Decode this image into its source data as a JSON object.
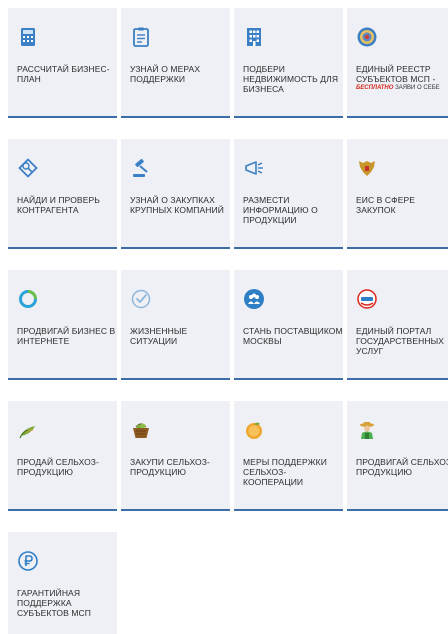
{
  "rows": [
    [
      {
        "label": "РАССЧИТАЙ БИЗНЕС-ПЛАН",
        "icon": "calculator-icon"
      },
      {
        "label": "УЗНАЙ О МЕРАХ ПОДДЕРЖКИ",
        "icon": "clipboard-icon"
      },
      {
        "label": "ПОДБЕРИ НЕДВИЖИМОСТЬ ДЛЯ БИЗНЕСА",
        "icon": "building-icon"
      },
      {
        "label": "ЕДИНЫЙ РЕЕСТР СУБЪЕКТОВ МСП -",
        "icon": "tax-service-emblem-icon",
        "note_red": "БЕСПЛАТНО",
        "note": "ЗАЯВИ О СЕБЕ"
      }
    ],
    [
      {
        "label": "НАЙДИ И ПРОВЕРЬ КОНТРАГЕНТА",
        "icon": "diamond-search-icon"
      },
      {
        "label": "УЗНАЙ О ЗАКУПКАХ КРУПНЫХ КОМПАНИЙ",
        "icon": "gavel-icon"
      },
      {
        "label": "РАЗМЕСТИ ИНФОРМАЦИЮ О ПРОДУКЦИИ",
        "icon": "megaphone-icon"
      },
      {
        "label": "ЕИС В СФЕРЕ ЗАКУПОК",
        "icon": "coat-of-arms-icon"
      }
    ],
    [
      {
        "label": "ПРОДВИГАЙ БИЗНЕС В ИНТЕРНЕТЕ",
        "icon": "ring-logo-icon"
      },
      {
        "label": "ЖИЗНЕННЫЕ СИТУАЦИИ",
        "icon": "checkmark-circle-icon"
      },
      {
        "label": "СТАНЬ ПОСТАВЩИКОМ МОСКВЫ",
        "icon": "people-circle-icon"
      },
      {
        "label": "ЕДИНЫЙ ПОРТАЛ ГОСУДАРСТВЕННЫХ УСЛУГ",
        "icon": "gosuslugi-logo-icon"
      }
    ],
    [
      {
        "label": "ПРОДАЙ СЕЛЬХОЗ-ПРОДУКЦИЮ",
        "icon": "sprout-icon"
      },
      {
        "label": "ЗАКУПИ СЕЛЬХОЗ-ПРОДУКЦИЮ",
        "icon": "basket-icon"
      },
      {
        "label": "МЕРЫ ПОДДЕРЖКИ СЕЛЬХОЗ-КООПЕРАЦИИ",
        "icon": "coin-leaf-icon"
      },
      {
        "label": "ПРОДВИГАЙ СЕЛЬХОЗ-ПРОДУКЦИЮ",
        "icon": "farmer-icon"
      }
    ],
    [
      {
        "label": "ГАРАНТИЙНАЯ ПОДДЕРЖКА СУБЪЕКТОВ МСП",
        "icon": "ruble-circle-icon"
      }
    ]
  ],
  "colors": {
    "tile_bg": "#eef0f5",
    "separator": "#3d6da6",
    "icon_blue": "#3b7fc4",
    "text": "#2c2c2c",
    "accent_red": "#d9261c"
  }
}
